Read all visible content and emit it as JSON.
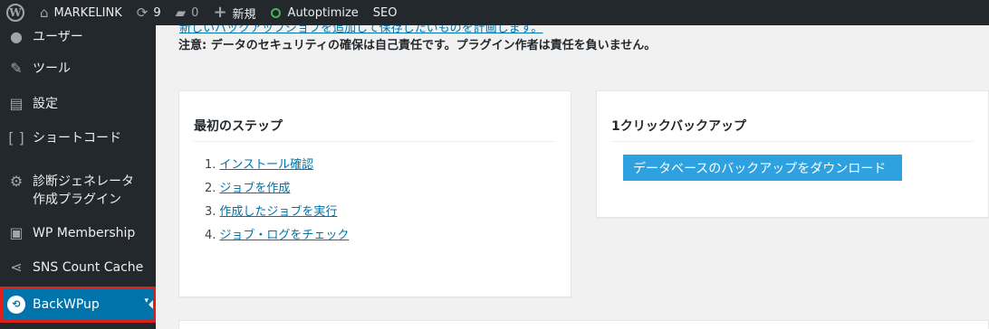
{
  "adminbar": {
    "site_name": "MARKELINK",
    "updates_count": "9",
    "comments_count": "0",
    "new_label": "新規",
    "autoptimize_label": "Autoptimize",
    "seo_label": "SEO"
  },
  "sidebar": {
    "items": [
      {
        "label": "ユーザー",
        "icon": "user-icon"
      },
      {
        "label": "ツール",
        "icon": "wrench-icon"
      },
      {
        "label": "設定",
        "icon": "settings-icon"
      },
      {
        "label": "ショートコード",
        "icon": "shortcode-icon"
      },
      {
        "label": "診断ジェネレータ",
        "label2": "作成プラグイン",
        "icon": "gear-icon"
      },
      {
        "label": "WP Membership",
        "icon": "id-card-icon"
      },
      {
        "label": "SNS Count Cache",
        "icon": "share-icon"
      },
      {
        "label": "BackWPup",
        "icon": "backwpup-icon"
      }
    ]
  },
  "main": {
    "notice_link_partial": "新しいバックアップジョブを追加して保存したいものを計画します。",
    "notice_warning": "注意: データのセキュリティの確保は自己責任です。プラグイン作者は責任を負いません。",
    "first_steps": {
      "title": "最初のステップ",
      "steps": [
        {
          "num": "1.",
          "label": "インストール確認"
        },
        {
          "num": "2.",
          "label": "ジョブを作成"
        },
        {
          "num": "3.",
          "label": "作成したジョブを実行"
        },
        {
          "num": "4.",
          "label": "ジョブ・ログをチェック"
        }
      ]
    },
    "one_click": {
      "title": "1クリックバックアップ",
      "button_label": "データベースのバックアップをダウンロード"
    }
  },
  "colors": {
    "adminbar_bg": "#23282d",
    "sidebar_bg": "#23282d",
    "current_menu_bg": "#0073aa",
    "highlight_border": "#e0201b",
    "button_bg": "#2ea2e0",
    "link": "#0073aa"
  }
}
